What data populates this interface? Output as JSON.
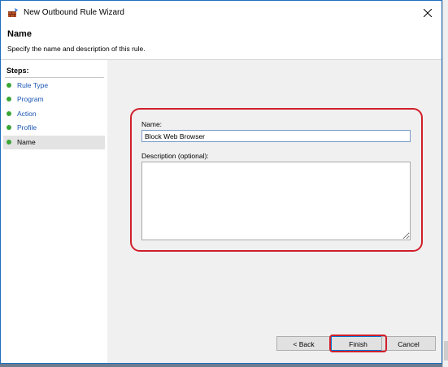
{
  "window": {
    "title": "New Outbound Rule Wizard"
  },
  "header": {
    "title": "Name",
    "description": "Specify the name and description of this rule."
  },
  "steps": {
    "title": "Steps:",
    "items": [
      {
        "label": "Rule Type",
        "active": false
      },
      {
        "label": "Program",
        "active": false
      },
      {
        "label": "Action",
        "active": false
      },
      {
        "label": "Profile",
        "active": false
      },
      {
        "label": "Name",
        "active": true
      }
    ]
  },
  "form": {
    "name_label": "Name:",
    "name_value": "Block Web Browser",
    "description_label": "Description (optional):",
    "description_value": ""
  },
  "buttons": {
    "back": "< Back",
    "finish": "Finish",
    "cancel": "Cancel"
  },
  "colors": {
    "accent": "#0078d7",
    "highlight_outline": "#d11f2a",
    "step_dot": "#3aa636",
    "link": "#1a56b4"
  },
  "icons": {
    "app": "firewall-rule-icon",
    "close": "close-icon",
    "step": "green-bullet-icon"
  }
}
